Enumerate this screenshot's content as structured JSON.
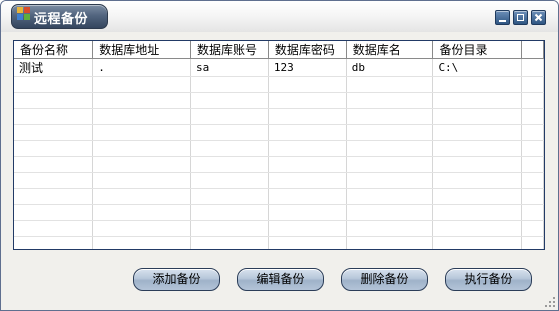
{
  "window": {
    "title": "远程备份"
  },
  "grid": {
    "columns": [
      "备份名称",
      "数据库地址",
      "数据库账号",
      "数据库密码",
      "数据库名",
      "备份目录"
    ],
    "rows": [
      [
        "测试",
        ".",
        "sa",
        "123",
        "db",
        "C:\\"
      ]
    ]
  },
  "buttons": {
    "add": "添加备份",
    "edit": "编辑备份",
    "delete": "删除备份",
    "run": "执行备份"
  },
  "icons": {
    "app": "app-logo-icon",
    "minimize": "minimize-icon",
    "maximize": "maximize-icon",
    "close": "close-icon",
    "resize": "resize-grip-icon"
  }
}
